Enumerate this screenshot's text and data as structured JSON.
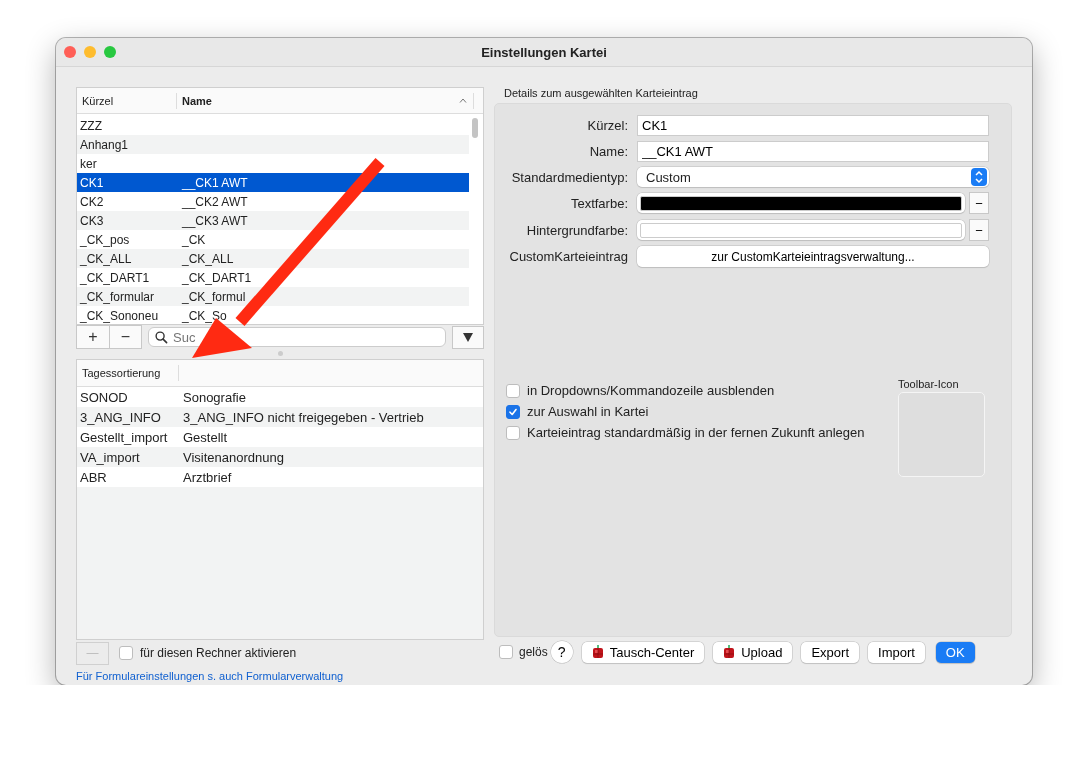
{
  "window": {
    "title": "Einstellungen Kartei"
  },
  "entry_table": {
    "columns": [
      {
        "label": "Kürzel",
        "sorted": false
      },
      {
        "label": "Name",
        "sorted": true
      }
    ],
    "rows": [
      {
        "cells": [
          "ZZZ",
          ""
        ],
        "selected": false
      },
      {
        "cells": [
          "Anhang1",
          ""
        ],
        "selected": false
      },
      {
        "cells": [
          "ker",
          ""
        ],
        "selected": false
      },
      {
        "cells": [
          "CK1",
          "__CK1 AWT"
        ],
        "selected": true
      },
      {
        "cells": [
          "CK2",
          "__CK2 AWT"
        ],
        "selected": false
      },
      {
        "cells": [
          "CK3",
          "__CK3 AWT"
        ],
        "selected": false
      },
      {
        "cells": [
          "_CK_pos",
          "_CK"
        ],
        "selected": false
      },
      {
        "cells": [
          "_CK_ALL",
          "_CK_ALL"
        ],
        "selected": false
      },
      {
        "cells": [
          "_CK_DART1",
          "_CK_DART1"
        ],
        "selected": false
      },
      {
        "cells": [
          "_CK_formular",
          "_CK_formul"
        ],
        "selected": false
      },
      {
        "cells": [
          "_CK_Sononeu",
          "_CK_So"
        ],
        "selected": false
      }
    ]
  },
  "entry_toolbar": {
    "buttons": [
      "+",
      "−"
    ],
    "search": {
      "placeholder": "Suc"
    }
  },
  "sort_table": {
    "columns": [
      "Tagessortierung"
    ],
    "rows": [
      {
        "cells": [
          "SONOD",
          "Sonografie"
        ]
      },
      {
        "cells": [
          "3_ANG_INFO",
          "3_ANG_INFO nicht freigegeben - Vertrieb"
        ]
      },
      {
        "cells": [
          "Gestellt_import",
          "Gestellt"
        ]
      },
      {
        "cells": [
          "VA_import",
          "Visitenanordnung"
        ]
      },
      {
        "cells": [
          "ABR",
          "Arztbrief"
        ]
      }
    ]
  },
  "sort_toolbar": {
    "button": "—",
    "checkbox": {
      "label": "für diesen Rechner aktivieren",
      "checked": false
    }
  },
  "link": "Für Formulareinstellungen s. auch Formularverwaltung",
  "details": {
    "title": "Details zum ausgewählten Karteieintrag",
    "fields": [
      {
        "kind": "text",
        "label": "Kürzel:",
        "value": "CK1"
      },
      {
        "kind": "text",
        "label": "Name:",
        "value": "__CK1 AWT"
      },
      {
        "kind": "select",
        "label": "Standardmedientyp:",
        "value": "Custom"
      },
      {
        "kind": "color",
        "label": "Textfarbe:",
        "color": "#000000",
        "clear": "−"
      },
      {
        "kind": "color",
        "label": "Hintergrundfarbe:",
        "color": "#ffffff",
        "clear": "−"
      },
      {
        "kind": "button",
        "label": "CustomKarteieintrag",
        "button": "zur CustomKarteieintragsverwaltung..."
      }
    ],
    "checkboxes": [
      {
        "label": "in Dropdowns/Kommandozeile ausblenden",
        "checked": false
      },
      {
        "label": "zur Auswahl in Kartei",
        "checked": true
      },
      {
        "label": "Karteieintrag standardmäßig in der fernen Zukunft anlegen",
        "checked": false
      }
    ],
    "toolbar_icon": {
      "label": "Toolbar-Icon"
    }
  },
  "footer": {
    "checkbox": {
      "label": "gelös",
      "checked": false
    },
    "help": "?",
    "buttons": [
      {
        "label": "Tausch-Center",
        "kind": "icon"
      },
      {
        "label": "Upload",
        "kind": "icon"
      },
      {
        "label": "Export",
        "kind": "plain"
      },
      {
        "label": "Import",
        "kind": "plain"
      },
      {
        "label": "OK",
        "kind": "default"
      }
    ]
  }
}
